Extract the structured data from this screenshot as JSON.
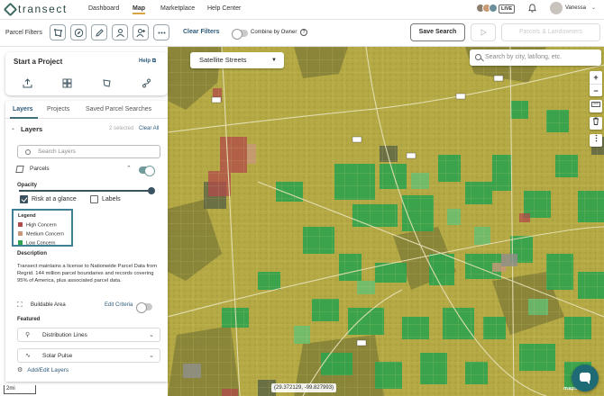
{
  "nav": {
    "logo_text": "transect",
    "links": [
      {
        "label": "Dashboard",
        "active": false
      },
      {
        "label": "Map",
        "active": true
      },
      {
        "label": "Marketplace",
        "active": false
      },
      {
        "label": "Help Center",
        "active": false
      }
    ],
    "live_badge": "LIVE",
    "user_name": "Vanessa",
    "avatar_colors": [
      "#8a7f6d",
      "#c99a73",
      "#6b8f9c"
    ]
  },
  "filterbar": {
    "label": "Parcel Filters",
    "icons": [
      "polygon-filter-icon",
      "compass-filter-icon",
      "pencil-filter-icon",
      "owner-filter-icon",
      "user-plus-filter-icon",
      "more-icon"
    ],
    "clear_label": "Clear Filters",
    "combine_label": "Combine by Owner",
    "combine_on": false,
    "help_glyph": "?",
    "save_search_label": "Save Search",
    "parcels_landowners_label": "Parcels & Landowners"
  },
  "map": {
    "basemap_label": "Satellite Streets",
    "search_placeholder": "Search by city, lat/long, etc.",
    "zoom_in": "+",
    "zoom_out": "−",
    "scale_label": "2mi",
    "coordinates": "(29.372129, -99.827993)",
    "attribution": "mapbox",
    "colors": {
      "high": "#b24a4a",
      "medium": "#c8977a",
      "low": "#2fa34e",
      "base": "#b6ab43"
    }
  },
  "start_project": {
    "title": "Start a Project",
    "help_label": "Help",
    "icons": [
      "upload-icon",
      "grid-icon",
      "polygon-draw-icon",
      "route-icon"
    ]
  },
  "layers_panel": {
    "tabs": [
      {
        "label": "Layers",
        "active": true
      },
      {
        "label": "Projects",
        "active": false
      },
      {
        "label": "Saved Parcel Searches",
        "active": false
      }
    ],
    "section_title": "Layers",
    "selected_text": "2 selected",
    "clear_all": "Clear All",
    "search_placeholder": "Search Layers",
    "parcels_label": "Parcels",
    "parcels_on": true,
    "opacity_label": "Opacity",
    "opacity_value": 1.0,
    "risk_label": "Risk at a glance",
    "risk_checked": true,
    "labels_label": "Labels",
    "labels_checked": false,
    "legend": {
      "title": "Legend",
      "items": [
        {
          "label": "High Concern",
          "color": "#b24a4a"
        },
        {
          "label": "Medium Concern",
          "color": "#c8977a"
        },
        {
          "label": "Low Concern",
          "color": "#2fa34e"
        }
      ]
    },
    "description_title": "Description",
    "description_text": "Transect maintains a license to Nationwide Parcel Data from Regrid. 144 million parcel boundaries and records covering 95% of America, plus associated parcel data.",
    "buildable_label": "Buildable Area",
    "edit_criteria": "Edit Criteria",
    "buildable_on": false,
    "featured_label": "Featured",
    "featured": [
      {
        "label": "Distribution Lines",
        "icon": "tower-icon"
      },
      {
        "label": "Solar Pulse",
        "icon": "pulse-icon"
      }
    ],
    "add_edit_label": "Add/Edit Layers"
  }
}
